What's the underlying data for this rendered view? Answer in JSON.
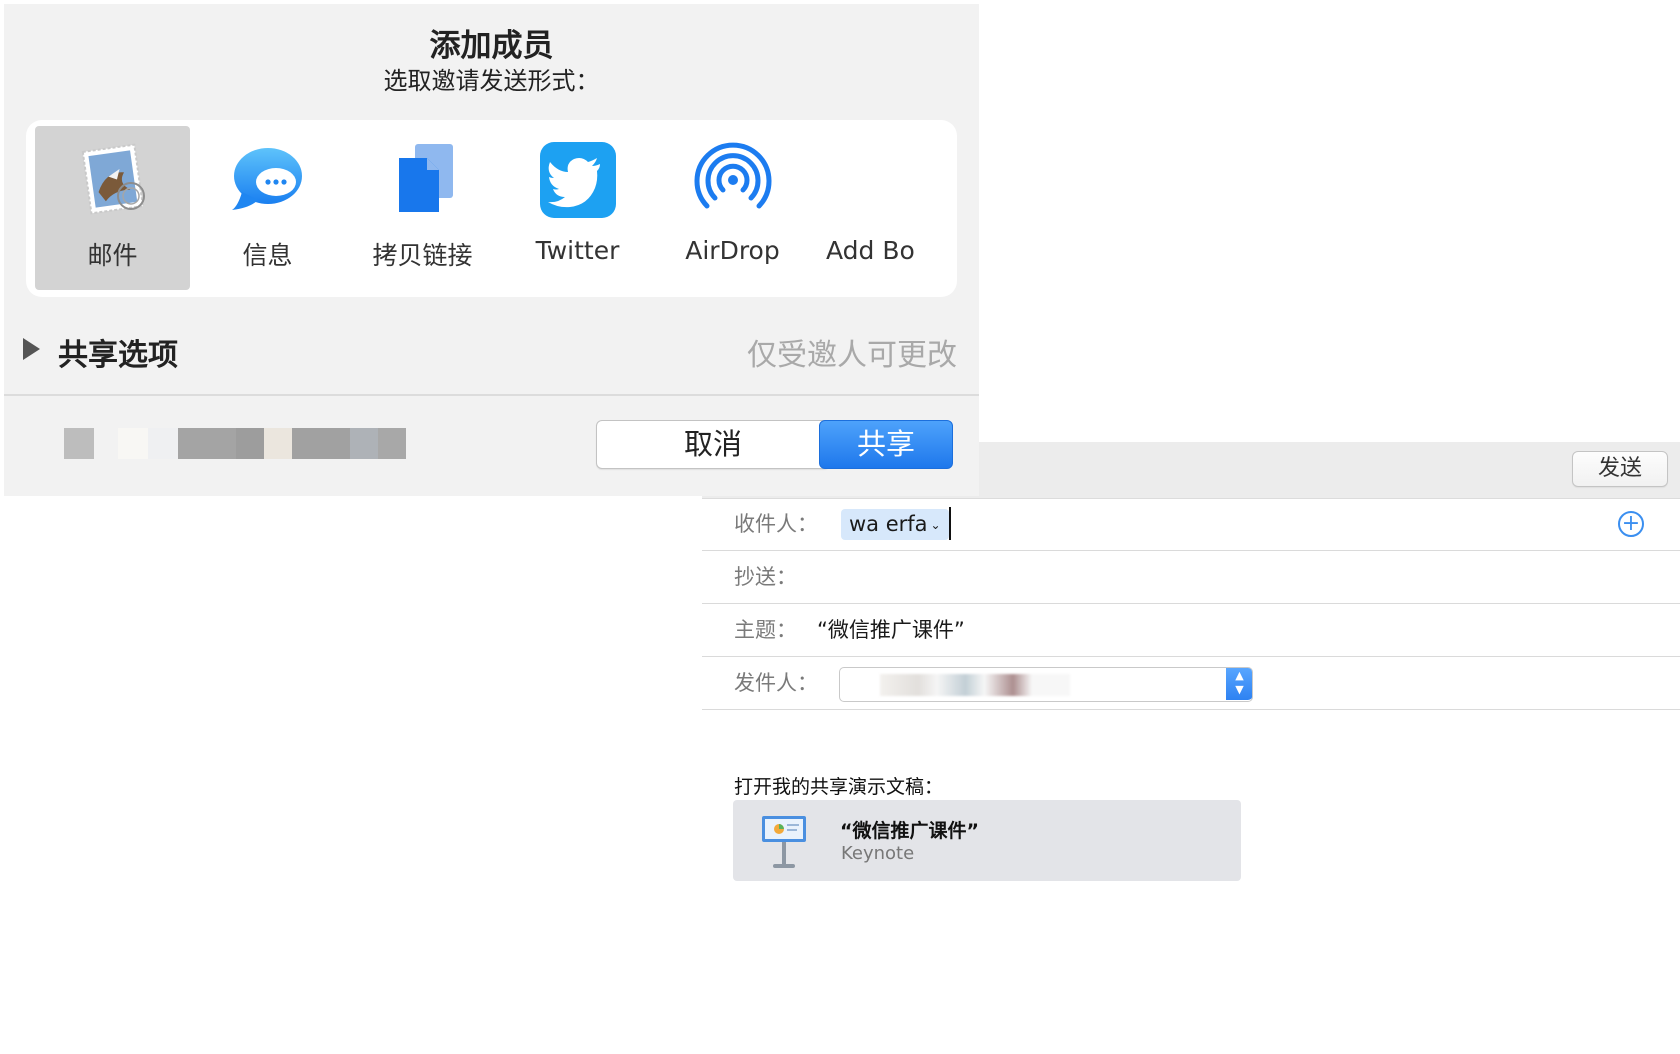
{
  "share_sheet": {
    "title": "添加成员",
    "subtitle": "选取邀请发送形式：",
    "apps": [
      {
        "label": "邮件",
        "icon": "mail-stamp-icon",
        "selected": true
      },
      {
        "label": "信息",
        "icon": "messages-bubble-icon",
        "selected": false
      },
      {
        "label": "拷贝链接",
        "icon": "copy-link-icon",
        "selected": false
      },
      {
        "label": "Twitter",
        "icon": "twitter-bird-icon",
        "selected": false
      },
      {
        "label": "AirDrop",
        "icon": "airdrop-icon",
        "selected": false
      },
      {
        "label": "Add Bo",
        "icon": "none",
        "selected": false
      }
    ],
    "options": {
      "label": "共享选项",
      "value": "仅受邀人可更改"
    },
    "cancel_label": "取消",
    "share_label": "共享"
  },
  "mail": {
    "send_label": "发送",
    "to_label": "收件人：",
    "to_token": "wa erfa",
    "cc_label": "抄送：",
    "subject_label": "主题：",
    "subject_value": "“微信推广课件”",
    "from_label": "发件人：",
    "share_caption": "打开我的共享演示文稿：",
    "document": {
      "title": "“微信推广课件”",
      "app": "Keynote"
    }
  },
  "colors": {
    "accent": "#2e82f2",
    "twitter": "#1da1f2",
    "sheet_background": "#f2f2f2",
    "selected_tile": "#d3d3d3",
    "token_background": "#d7e8fb"
  }
}
